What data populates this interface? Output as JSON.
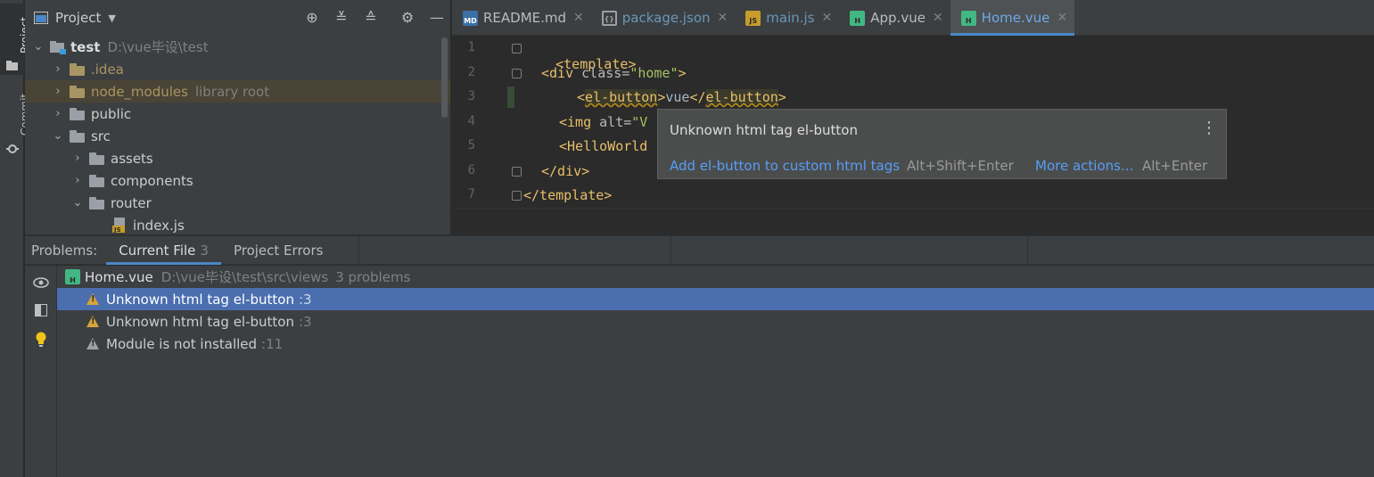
{
  "left_strip": {
    "project_label": "Project",
    "commit_label": "Commit"
  },
  "project_panel": {
    "title": "Project",
    "tree": [
      {
        "name": "test",
        "hint": "D:\\vue毕设\\test",
        "depth": 0,
        "expanded": true,
        "bold": true
      },
      {
        "name": ".idea",
        "hint": "",
        "depth": 1,
        "expanded": false,
        "color": "#a89564"
      },
      {
        "name": "node_modules",
        "hint": "library root",
        "depth": 1,
        "expanded": false,
        "color": "#a89564",
        "highlight": true
      },
      {
        "name": "public",
        "hint": "",
        "depth": 1,
        "expanded": false
      },
      {
        "name": "src",
        "hint": "",
        "depth": 1,
        "expanded": true
      },
      {
        "name": "assets",
        "hint": "",
        "depth": 2,
        "expanded": false
      },
      {
        "name": "components",
        "hint": "",
        "depth": 2,
        "expanded": false
      },
      {
        "name": "router",
        "hint": "",
        "depth": 2,
        "expanded": true
      },
      {
        "name": "index.js",
        "hint": "",
        "depth": 3,
        "file": true
      }
    ]
  },
  "editor_tabs": [
    {
      "label": "README.md",
      "icon": "MD",
      "type": "md",
      "active": false
    },
    {
      "label": "package.json",
      "icon": "{}",
      "type": "json",
      "active": false,
      "modified": true
    },
    {
      "label": "main.js",
      "icon": "JS",
      "type": "js",
      "active": false,
      "modified": true
    },
    {
      "label": "App.vue",
      "icon": "H",
      "type": "vue",
      "active": false
    },
    {
      "label": "Home.vue",
      "icon": "H",
      "type": "vue",
      "active": true
    }
  ],
  "code": {
    "line_numbers": [
      "1",
      "2",
      "3",
      "4",
      "5",
      "6",
      "7"
    ],
    "line1_tag": "<template>",
    "line2_open": "<div ",
    "line2_attr": "class=",
    "line2_str": "\"home\"",
    "line2_close": ">",
    "line3_lt": "<",
    "line3_tag": "el-button",
    "line3_gt": ">",
    "line3_text": "vue",
    "line3_lt2": "</",
    "line3_tag2": "el-button",
    "line3_gt2": ">",
    "line4_open": "<img ",
    "line4_attr": "alt=",
    "line4_str": "\"V",
    "line5_tag": "<HelloWorld",
    "line6_tag": "</div>",
    "line7_tag": "</template>"
  },
  "tooltip": {
    "message": "Unknown html tag el-button",
    "fix_link": "Add el-button to custom html tags",
    "fix_shortcut": "Alt+Shift+Enter",
    "more_link": "More actions...",
    "more_shortcut": "Alt+Enter"
  },
  "problems": {
    "title": "Problems:",
    "tabs": [
      {
        "label": "Current File",
        "count": "3",
        "active": true
      },
      {
        "label": "Project Errors",
        "count": "",
        "active": false
      }
    ],
    "file": {
      "name": "Home.vue",
      "path": "D:\\vue毕设\\test\\src\\views",
      "count_text": "3 problems"
    },
    "items": [
      {
        "text": "Unknown html tag el-button",
        "line": ":3",
        "selected": true,
        "severity": "warning"
      },
      {
        "text": "Unknown html tag el-button",
        "line": ":3",
        "selected": false,
        "severity": "warning"
      },
      {
        "text": "Module is not installed",
        "line": ":11",
        "selected": false,
        "severity": "weak"
      }
    ]
  }
}
